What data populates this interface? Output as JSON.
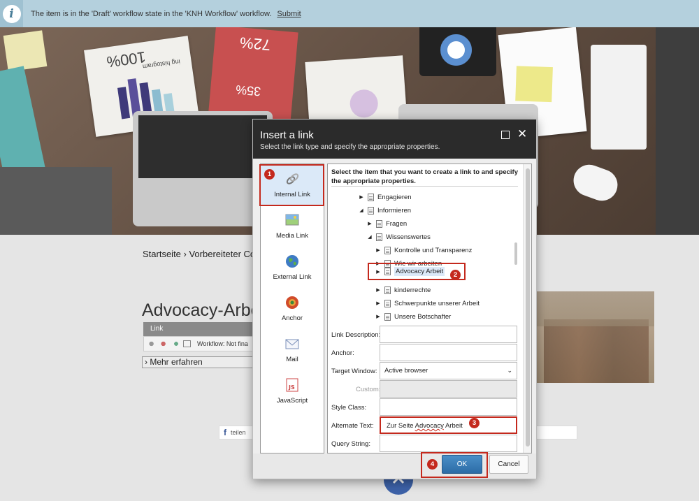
{
  "notification": {
    "message": "The item is in the 'Draft' workflow state in the 'KNH Workflow' workflow.",
    "action": "Submit"
  },
  "page": {
    "breadcrumb": "Startseite › Vorbereiteter Co",
    "title": "Advocacy-Arbe",
    "toolbar_label": "Link",
    "workflow_text": "Workflow: Not fina",
    "mehr_link": "› Mehr erfahren",
    "share_label": "teilen"
  },
  "hero_text": {
    "stat_a": "100%",
    "stat_b": "72%",
    "stat_c": "35%",
    "histogram_label": "ing histogram"
  },
  "dialog": {
    "title": "Insert a link",
    "subtitle": "Select the link type and specify the appropriate properties.",
    "link_types": [
      {
        "label": "Internal Link",
        "icon": "internal-link-icon",
        "selected": true
      },
      {
        "label": "Media Link",
        "icon": "media-link-icon",
        "selected": false
      },
      {
        "label": "External Link",
        "icon": "globe-icon",
        "selected": false
      },
      {
        "label": "Anchor",
        "icon": "anchor-icon",
        "selected": false
      },
      {
        "label": "Mail",
        "icon": "mail-icon",
        "selected": false
      },
      {
        "label": "JavaScript",
        "icon": "javascript-icon",
        "selected": false
      }
    ],
    "instruction": "Select the item that you want to create a link to and specify the appropriate properties.",
    "tree": [
      {
        "label": "Engagieren",
        "expanded": false
      },
      {
        "label": "Informieren",
        "expanded": true
      },
      {
        "label": "Fragen",
        "expanded": false
      },
      {
        "label": "Wissenswertes",
        "expanded": true
      },
      {
        "label": "Kontrolle und Transparenz",
        "expanded": false
      },
      {
        "label": "Wie wir arbeiten",
        "expanded": false
      },
      {
        "label": "Advocacy Arbeit",
        "expanded": false,
        "selected": true
      },
      {
        "label": "kinderrechte",
        "expanded": false
      },
      {
        "label": "Schwerpunkte unserer Arbeit",
        "expanded": false
      },
      {
        "label": "Unsere Botschafter",
        "expanded": false
      }
    ],
    "form": {
      "link_description_label": "Link Description:",
      "link_description_value": "",
      "anchor_label": "Anchor:",
      "anchor_value": "",
      "target_window_label": "Target Window:",
      "target_window_value": "Active browser",
      "custom_label": "Custom:",
      "custom_value": "",
      "style_class_label": "Style Class:",
      "style_class_value": "",
      "alternate_text_label": "Alternate Text:",
      "alternate_text_prefix": "Zur Seite ",
      "alternate_text_mid": "Advocacy",
      "alternate_text_suffix": " Arbeit",
      "query_string_label": "Query String:",
      "query_string_value": ""
    },
    "ok_label": "OK",
    "cancel_label": "Cancel"
  },
  "callouts": [
    "1",
    "2",
    "3",
    "4"
  ],
  "colors": {
    "callout_red": "#c4291d",
    "ok_blue": "#2c6ca6",
    "notification_bg": "#b4d0dd",
    "fab_blue": "#3d62a8"
  }
}
